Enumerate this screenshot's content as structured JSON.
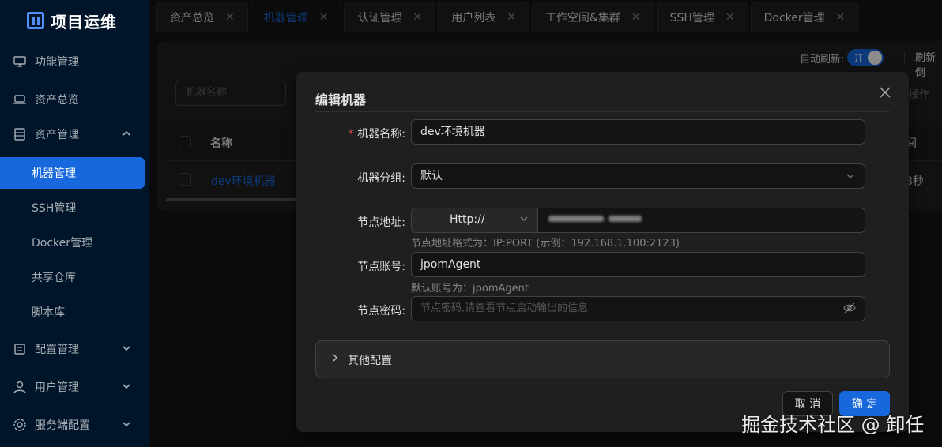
{
  "app": {
    "title": "项目运维"
  },
  "sidebar": {
    "menus": [
      {
        "label": "功能管理",
        "icon": "monitor-icon"
      },
      {
        "label": "资产总览",
        "icon": "laptop-icon"
      },
      {
        "label": "资产管理",
        "icon": "database-icon",
        "expanded": true
      },
      {
        "label": "配置管理",
        "icon": "settings-icon"
      },
      {
        "label": "用户管理",
        "icon": "user-icon"
      },
      {
        "label": "服务端配置",
        "icon": "gear-icon"
      }
    ],
    "sub_items": [
      "机器管理",
      "SSH管理",
      "Docker管理",
      "共享仓库",
      "脚本库"
    ],
    "active_sub": "机器管理"
  },
  "tabs": [
    {
      "label": "资产总览",
      "active": false
    },
    {
      "label": "机器管理",
      "active": true
    },
    {
      "label": "认证管理",
      "active": false
    },
    {
      "label": "用户列表",
      "active": false
    },
    {
      "label": "工作空间&集群",
      "active": false
    },
    {
      "label": "SSH管理",
      "active": false
    },
    {
      "label": "Docker管理",
      "active": false
    }
  ],
  "toolbar": {
    "auto_refresh_label": "自动刷新:",
    "switch_label": "开",
    "refresh_label": "刷新倒"
  },
  "background": {
    "search_placeholder": "机器名称",
    "ops_label": "操作",
    "col_name": "名称",
    "col_right": "间",
    "row_name": "dev环境机器",
    "row_right": "8秒"
  },
  "modal": {
    "title": "编辑机器",
    "fields": {
      "name_label": "机器名称:",
      "name_value": "dev环境机器",
      "group_label": "机器分组:",
      "group_value": "默认",
      "addr_label": "节点地址:",
      "protocol": "Http://",
      "addr_help": "节点地址格式为：IP:PORT (示例：192.168.1.100:2123)",
      "account_label": "节点账号:",
      "account_value": "jpomAgent",
      "account_help": "默认账号为：jpomAgent",
      "password_label": "节点密码:",
      "password_placeholder": "节点密码,请查看节点启动输出的信息"
    },
    "collapse_label": "其他配置",
    "cancel_label": "取 消",
    "ok_label": "确 定"
  },
  "watermark": "掘金技术社区 @ 卸任",
  "colors": {
    "primary": "#1668dc",
    "sidebar_bg": "#001529",
    "required": "#dc4446"
  }
}
